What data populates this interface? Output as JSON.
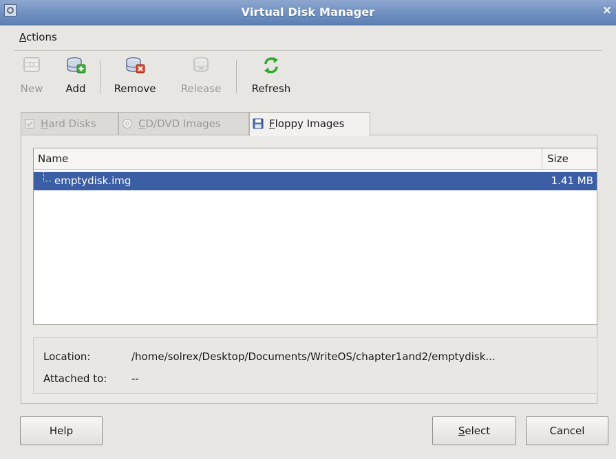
{
  "window": {
    "title": "Virtual Disk Manager",
    "close_glyph": "×"
  },
  "menu": {
    "actions": {
      "mnemonic": "A",
      "rest": "ctions"
    }
  },
  "toolbar": {
    "new": {
      "label": "New",
      "icon": "new-disk-icon",
      "enabled": false
    },
    "add": {
      "label": "Add",
      "icon": "add-disk-icon",
      "enabled": true
    },
    "remove": {
      "label": "Remove",
      "icon": "remove-disk-icon",
      "enabled": true
    },
    "release": {
      "label": "Release",
      "icon": "release-disk-icon",
      "enabled": false
    },
    "refresh": {
      "label": "Refresh",
      "icon": "refresh-icon",
      "enabled": true
    }
  },
  "tabs": {
    "hard_disks": {
      "mnemonic": "H",
      "rest": "ard Disks",
      "active": false
    },
    "cd_dvd": {
      "mnemonic": "C",
      "rest": "D/DVD Images",
      "active": false
    },
    "floppy": {
      "mnemonic": "F",
      "rest": "loppy Images",
      "active": true
    }
  },
  "table": {
    "columns": [
      "Name",
      "Size"
    ],
    "rows": [
      {
        "name": "emptydisk.img",
        "size": "1.41 MB",
        "selected": true
      }
    ]
  },
  "details": {
    "location_label": "Location:",
    "location_value": "/home/solrex/Desktop/Documents/WriteOS/chapter1and2/emptydisk...",
    "attached_label": "Attached to:",
    "attached_value": "--"
  },
  "buttons": {
    "help": "Help",
    "select": {
      "mnemonic": "S",
      "rest": "elect"
    },
    "cancel": "Cancel"
  },
  "colors": {
    "titlebar": "#6f8fc0",
    "selection": "#3c5ea4",
    "refresh_green": "#2fa82f"
  }
}
